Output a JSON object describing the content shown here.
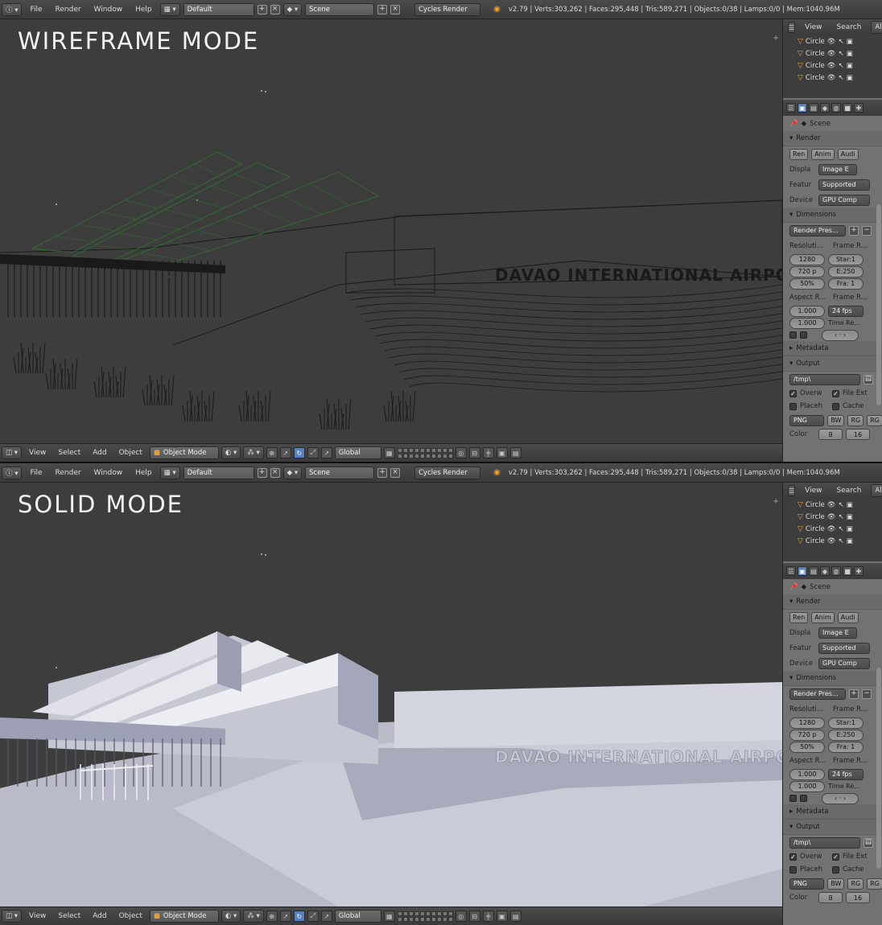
{
  "panes": [
    {
      "key": "wireframe",
      "title": "WIREFRAME MODE",
      "render_mode": "wireframe"
    },
    {
      "key": "solid",
      "title": "SOLID MODE",
      "render_mode": "solid"
    }
  ],
  "info_header": {
    "menus": [
      "File",
      "Render",
      "Window",
      "Help"
    ],
    "layout": "Default",
    "scene": "Scene",
    "engine": "Cycles Render",
    "stats": "v2.79 | Verts:303,262 | Faces:295,448 | Tris:589,271 | Objects:0/38 | Lamps:0/0 | Mem:1040.96M"
  },
  "viewport_footer": {
    "menus": [
      "View",
      "Select",
      "Add",
      "Object"
    ],
    "mode": "Object Mode",
    "orientation": "Global"
  },
  "viewport_text": {
    "airport_sign": "DAVAO INTERNATIONAL AIRPORT"
  },
  "outliner": {
    "header": [
      "View",
      "Search",
      "All"
    ],
    "items": [
      "Circle",
      "Circle",
      "Circle",
      "Circle"
    ]
  },
  "properties": {
    "context": "Scene",
    "render": {
      "title": "Render",
      "buttons": [
        "Ren",
        "Anim",
        "Audi"
      ],
      "display_label": "Displa",
      "display_value": "Image E",
      "feature_label": "Featur",
      "feature_value": "Supported",
      "device_label": "Device",
      "device_value": "GPU Comp"
    },
    "dimensions": {
      "title": "Dimensions",
      "preset": "Render Pres...",
      "resolution_label": "Resoluti...",
      "frame_range_label": "Frame R...",
      "res_x": "1280",
      "res_y": "720 p",
      "res_pct": "50%",
      "start": "Star:1",
      "end": "E:250",
      "frame": "Fra: 1",
      "aspect_label": "Aspect R...",
      "frame_rate_label": "Frame R...",
      "aspect_x": "1.000",
      "aspect_y": "1.000",
      "fps": "24 fps",
      "time_remap_label": "Time Re..."
    },
    "metadata": {
      "title": "Metadata"
    },
    "output": {
      "title": "Output",
      "path": "/tmp\\",
      "overwrite": "Overw",
      "file_ext": "File Ext",
      "placeholders": "Placeh",
      "cache": "Cache",
      "format": "PNG",
      "color_modes": [
        "BW",
        "RG",
        "RG"
      ],
      "color_label": "Color",
      "depths": [
        "8",
        "16"
      ]
    }
  },
  "colors": {
    "accent": "#5680c2",
    "wire": "#1a1a1a",
    "wire_selected": "#2f6b2f",
    "solid_light": "#c6c8d4",
    "solid_shadow": "#8c8fa3"
  }
}
